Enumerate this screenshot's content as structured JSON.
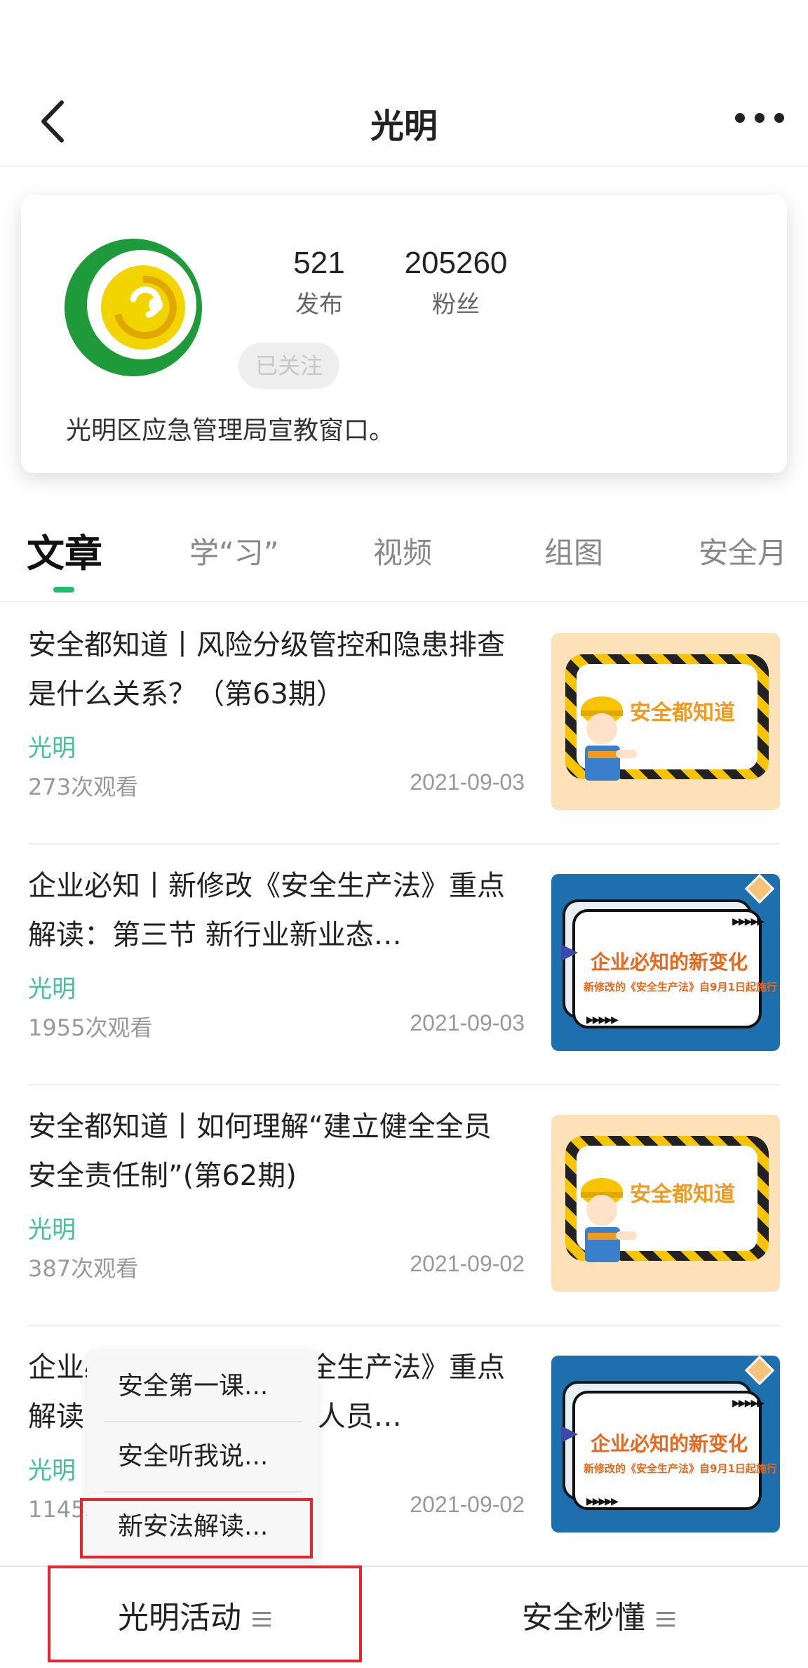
{
  "header": {
    "title": "光明"
  },
  "profile": {
    "stats": [
      {
        "value": "521",
        "label": "发布"
      },
      {
        "value": "205260",
        "label": "粉丝"
      }
    ],
    "follow_label": "已关注",
    "description": "光明区应急管理局宣教窗口。"
  },
  "tabs": [
    {
      "label": "文章",
      "active": true
    },
    {
      "label": "学“习”",
      "active": false
    },
    {
      "label": "视频",
      "active": false
    },
    {
      "label": "组图",
      "active": false
    },
    {
      "label": "安全月",
      "active": false
    }
  ],
  "articles": [
    {
      "title": "安全都知道丨风险分级管控和隐患排查是什么关系？（第63期）",
      "source": "光明",
      "views": "273次观看",
      "date": "2021-09-03",
      "thumb": {
        "style": "orange",
        "text": "安全都知道"
      }
    },
    {
      "title": "企业必知丨新修改《安全生产法》重点解读：第三节 新行业新业态…",
      "source": "光明",
      "views": "1955次观看",
      "date": "2021-09-03",
      "thumb": {
        "style": "blue",
        "text": "企业必知的新变化",
        "subtext": "新修改的《安全生产法》自9月1日起施行"
      }
    },
    {
      "title": "安全都知道丨如何理解“建立健全全员安全责任制”(第62期)",
      "source": "光明",
      "views": "387次观看",
      "date": "2021-09-02",
      "thumb": {
        "style": "orange",
        "text": "安全都知道"
      }
    },
    {
      "title": "企业必知丨新修改《安全生产法》重点解读：第二节 安全管理人员…",
      "source": "光明",
      "views": "1145次观看",
      "date": "2021-09-02",
      "thumb": {
        "style": "blue",
        "text": "企业必知的新变化",
        "subtext": "新修改的《安全生产法》自9月1日起施行"
      }
    }
  ],
  "popup_menu": {
    "items": [
      {
        "label": "安全第一课..."
      },
      {
        "label": "安全听我说..."
      },
      {
        "label": "新安法解读..."
      }
    ]
  },
  "bottom_bar": {
    "items": [
      {
        "label": "光明活动"
      },
      {
        "label": "安全秒懂"
      }
    ]
  },
  "colors": {
    "accent_green": "#1fbe6b",
    "source_green": "#3fc29a",
    "highlight_red": "#e8242e"
  }
}
